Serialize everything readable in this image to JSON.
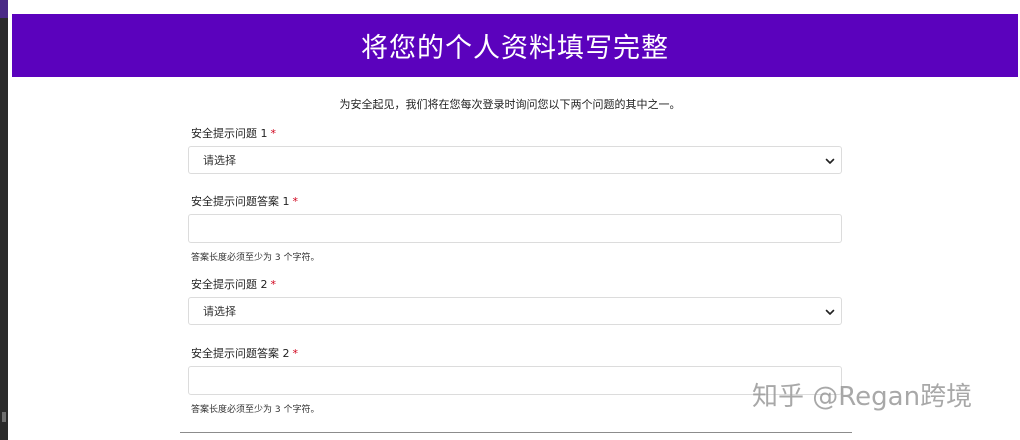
{
  "header": {
    "title": "将您的个人资料填写完整"
  },
  "intro": {
    "text": "为安全起见，我们将在您每次登录时询问您以下两个问题的其中之一。"
  },
  "form": {
    "q1_label": "安全提示问题 1",
    "q1_selected": "请选择",
    "a1_label": "安全提示问题答案 1",
    "a1_value": "",
    "a1_help": "答案长度必须至少为 3 个字符。",
    "q2_label": "安全提示问题 2",
    "q2_selected": "请选择",
    "a2_label": "安全提示问题答案 2",
    "a2_value": "",
    "a2_help": "答案长度必须至少为 3 个字符。",
    "required_mark": "*"
  },
  "watermark": {
    "text": "知乎 @Regan跨境"
  },
  "colors": {
    "header_bg": "#5b02bd",
    "required": "#d0021b"
  },
  "icons": {
    "select_arrow": "chevron-down-icon"
  }
}
